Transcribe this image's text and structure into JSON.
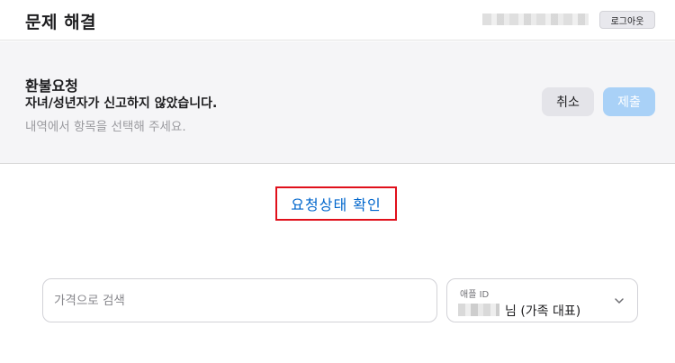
{
  "header": {
    "title": "문제 해결",
    "logout_label": "로그아웃"
  },
  "request": {
    "title": "환불요청",
    "reason": "자녀/성년자가 신고하지 않았습니다.",
    "hint": "내역에서 항목을 선택해 주세요.",
    "cancel_label": "취소",
    "submit_label": "제출"
  },
  "status_link": {
    "label": "요청상태 확인"
  },
  "search": {
    "placeholder": "가격으로 검색"
  },
  "apple_id": {
    "label": "애플 ID",
    "value_suffix": "님 (가족 대표)"
  },
  "icons": {
    "dropdown": "chevron-down-icon"
  },
  "colors": {
    "link": "#0066cc",
    "highlight_border": "#e0101b",
    "submit_disabled": "#a9d1f7"
  }
}
